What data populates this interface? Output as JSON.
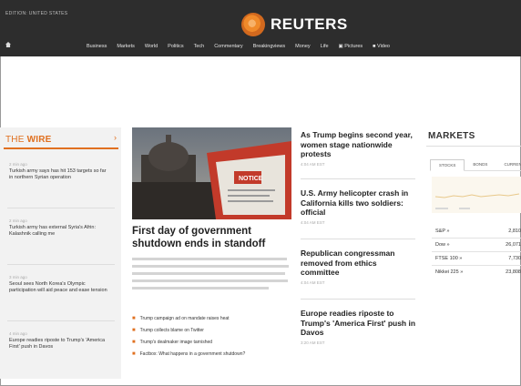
{
  "header": {
    "edition": "EDITION: UNITED STATES",
    "logo_text": "REUTERS",
    "nav": [
      "Business",
      "Markets",
      "World",
      "Politics",
      "Tech",
      "Commentary",
      "Breakingviews",
      "Money",
      "Life",
      "Pictures",
      "Video"
    ]
  },
  "wire": {
    "title_prefix": "THE",
    "title_suffix": "WIRE",
    "items": [
      {
        "time": "2 min ago",
        "text": "Turkish army says has hit 153 targets so far in northern Syrian operation"
      },
      {
        "time": "2 min ago",
        "text": "Turkish army has external Syria's Afrin: Kalashnik calling me"
      },
      {
        "time": "3 min ago",
        "text": "Seoul sees North Korea's Olympic participation will aid peace and ease tension"
      },
      {
        "time": "4 min ago",
        "text": "Europe readies riposte to Trump's 'America First' push in Davos"
      }
    ]
  },
  "hero": {
    "sign_text": "NOTICE",
    "title": "First day of government shutdown ends in standoff",
    "bullets": [
      "Trump campaign ad on mandate raises heat",
      "Trump collects blame on Twitter",
      "Trump's dealmaker image tarnished",
      "Factbox: What happens in a government shutdown?"
    ]
  },
  "stories": [
    {
      "title": "As Trump begins second year, women stage nationwide protests",
      "time": "4:04 AM EST"
    },
    {
      "title": "U.S. Army helicopter crash in California kills two soldiers: official",
      "time": "4:04 AM EST"
    },
    {
      "title": "Republican congressman removed from ethics committee",
      "time": "4:04 AM EST"
    },
    {
      "title": "Europe readies riposte to Trump's 'America First' push in Davos",
      "time": "3:20 AM EST"
    }
  ],
  "markets": {
    "title": "MARKETS",
    "tabs": [
      "STOCKS",
      "BONDS",
      "CURRENCIES"
    ],
    "quotes": [
      {
        "name": "S&P »",
        "value": "2,810"
      },
      {
        "name": "Dow »",
        "value": "26,071"
      },
      {
        "name": "FTSE 100 »",
        "value": "7,730"
      },
      {
        "name": "Nikkei 225 »",
        "value": "23,808"
      }
    ]
  },
  "colors": {
    "accent": "#e07020",
    "topbar": "#2d2d2d"
  },
  "icons": [
    "home-icon",
    "reuters-logo-icon",
    "pictures-icon",
    "video-icon",
    "chevron-right-icon"
  ]
}
